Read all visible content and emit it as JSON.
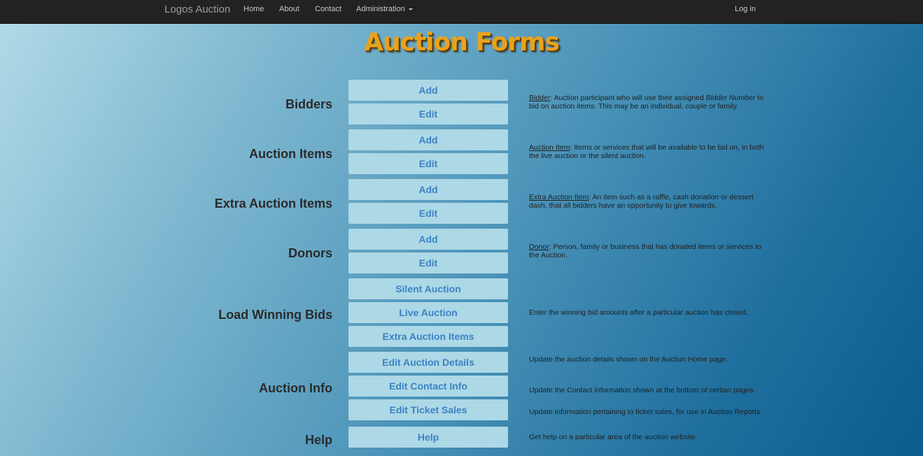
{
  "navbar": {
    "brand": "Logos Auction",
    "links": [
      "Home",
      "About",
      "Contact",
      "Administration"
    ],
    "login": "Log in"
  },
  "page_title": "Auction Forms",
  "sections": {
    "bidders": {
      "label": "Bidders",
      "buttons": [
        "Add",
        "Edit"
      ],
      "desc": {
        "term": "Bidder",
        "text1": ": Auction participant who will use their assigned ",
        "italic": "Bidder Number",
        "text2": " to bid on auction items. This may be an individual, couple or family."
      }
    },
    "auction_items": {
      "label": "Auction Items",
      "buttons": [
        "Add",
        "Edit"
      ],
      "desc": {
        "term": "Auction Item",
        "text": ": Items or services that will be available to be bid on, in both the live auction or the silent auction."
      }
    },
    "extra_items": {
      "label": "Extra Auction Items",
      "buttons": [
        "Add",
        "Edit"
      ],
      "desc": {
        "term": "Extra Auction Item",
        "text": ": An item such as a raffle, cash donation or dessert dash, that all bidders have an opportunity to give towards."
      }
    },
    "donors": {
      "label": "Donors",
      "buttons": [
        "Add",
        "Edit"
      ],
      "desc": {
        "term": "Donor",
        "text": ": Person, family or business that has donated items or services to the Auction."
      }
    },
    "winning_bids": {
      "label": "Load Winning Bids",
      "buttons": [
        "Silent Auction",
        "Live Auction",
        "Extra Auction Items"
      ],
      "desc": "Enter the winning bid amounts after a particular auction has closed."
    },
    "auction_info": {
      "label": "Auction Info",
      "buttons": [
        "Edit Auction Details",
        "Edit Contact Info",
        "Edit Ticket Sales"
      ],
      "descs": [
        "Update the auction details shown on the Auction Home page.",
        "Update the Contact information shown at the bottom of certian pages.",
        "Update information pertaining to ticket sales, for use in Auction Reports."
      ]
    },
    "help": {
      "label": "Help",
      "buttons": [
        "Help"
      ],
      "desc": "Get help on a particular area of the auction website."
    }
  }
}
